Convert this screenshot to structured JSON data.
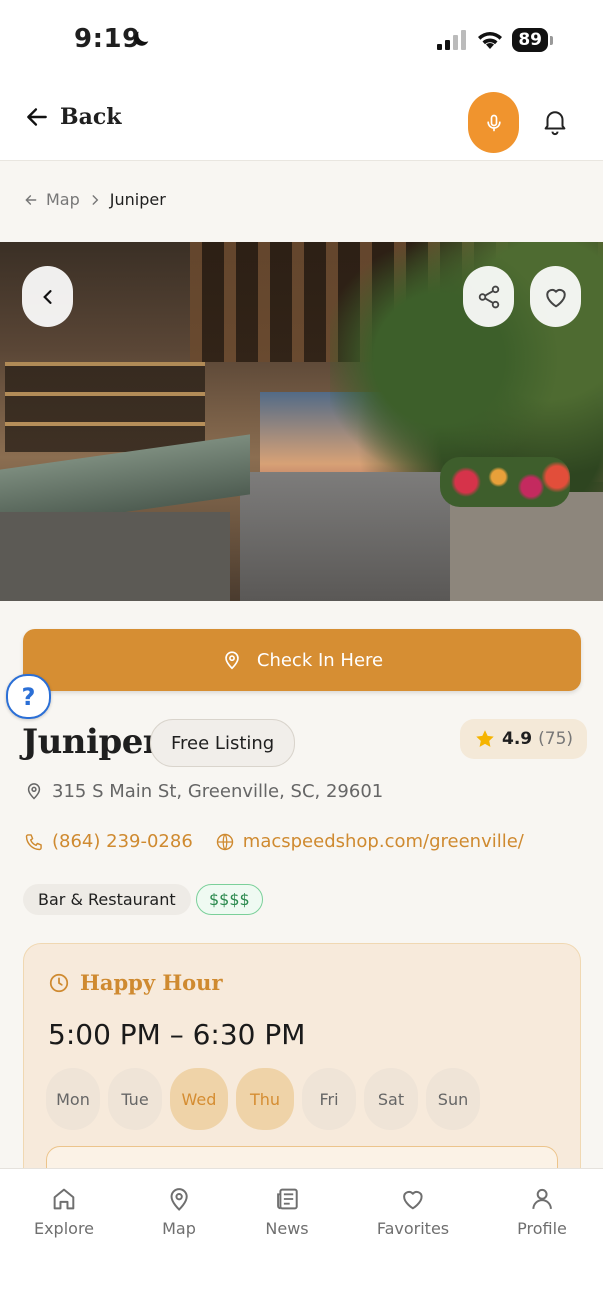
{
  "status_bar": {
    "time": "9:19",
    "battery": "89"
  },
  "header": {
    "back_label": "Back"
  },
  "breadcrumb": {
    "parent": "Map",
    "current": "Juniper"
  },
  "actions": {
    "check_in_label": "Check In Here",
    "help_glyph": "?"
  },
  "venue": {
    "name": "Juniper",
    "listing_type": "Free Listing",
    "rating": "4.9",
    "rating_count": "(75)",
    "address": "315 S Main St, Greenville, SC, 29601",
    "phone": "(864) 239-0286",
    "website": "macspeedshop.com/greenville/",
    "category": "Bar & Restaurant",
    "price": "$$$$"
  },
  "happy_hour": {
    "title": "Happy Hour",
    "time": "5:00 PM – 6:30 PM",
    "days": [
      {
        "label": "Mon",
        "active": false
      },
      {
        "label": "Tue",
        "active": false
      },
      {
        "label": "Wed",
        "active": true
      },
      {
        "label": "Thu",
        "active": true
      },
      {
        "label": "Fri",
        "active": false
      },
      {
        "label": "Sat",
        "active": false
      },
      {
        "label": "Sun",
        "active": false
      }
    ]
  },
  "bottom_nav": {
    "items": [
      {
        "label": "Explore",
        "icon": "home-icon"
      },
      {
        "label": "Map",
        "icon": "map-pin-icon"
      },
      {
        "label": "News",
        "icon": "newspaper-icon"
      },
      {
        "label": "Favorites",
        "icon": "heart-icon"
      },
      {
        "label": "Profile",
        "icon": "user-icon"
      }
    ]
  },
  "colors": {
    "accent": "#d68e33",
    "mic": "#f0942e",
    "price_green": "#2b8a4e",
    "help_blue": "#2b6fd6"
  }
}
